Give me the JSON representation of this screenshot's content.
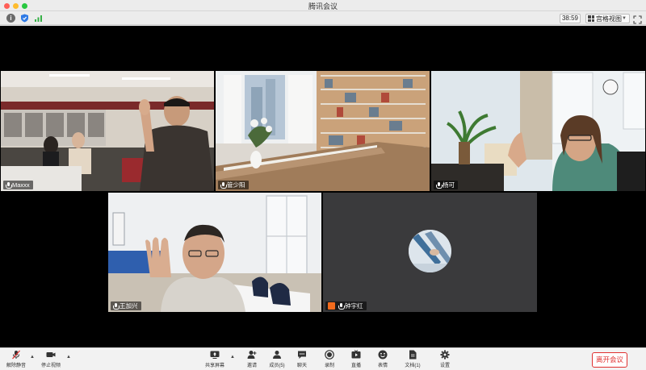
{
  "window": {
    "title": "腾讯会议"
  },
  "header": {
    "timer": "38:59",
    "view_mode": "宫格视图",
    "icons": [
      "info-icon",
      "shield-icon",
      "signal-icon",
      "fullscreen-icon"
    ]
  },
  "participants": [
    {
      "name": "Maxxx"
    },
    {
      "name": "管少阳"
    },
    {
      "name": "杨可"
    },
    {
      "name": "王加兴"
    },
    {
      "name": "钟宇红"
    }
  ],
  "toolbar": {
    "unmute": "解除静音",
    "stop_video": "停止视频",
    "share_screen": "共享屏幕",
    "invite": "邀请",
    "members": "成员(5)",
    "chat": "聊天",
    "record": "录制",
    "live": "直播",
    "reactions": "表情",
    "docs": "文档(1)",
    "settings": "设置",
    "leave": "离开会议"
  },
  "colors": {
    "accent_red": "#e0302f",
    "stage_bg": "#000000",
    "muted_tile_bg": "#3a3a3c"
  }
}
